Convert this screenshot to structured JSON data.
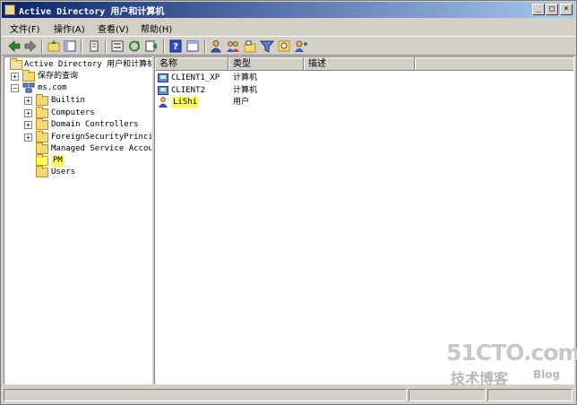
{
  "window": {
    "title": "Active Directory 用户和计算机",
    "minimize": "_",
    "maximize": "□",
    "close": "×"
  },
  "menu": {
    "items": [
      "文件(F)",
      "操作(A)",
      "查看(V)",
      "帮助(H)"
    ]
  },
  "tree": {
    "root": "Active Directory 用户和计算机",
    "saved_queries": "保存的查询",
    "domain": "ms.com",
    "children": [
      "Builtin",
      "Computers",
      "Domain Controllers",
      "ForeignSecurityPrincip",
      "Managed Service Accour",
      "PM",
      "Users"
    ],
    "selected": "PM"
  },
  "list": {
    "columns": [
      "名称",
      "类型",
      "描述"
    ],
    "rows": [
      {
        "name": "CLIENT1_XP",
        "type": "计算机",
        "icon": "computer-icon"
      },
      {
        "name": "CLIENT2",
        "type": "计算机",
        "icon": "computer-icon"
      },
      {
        "name": "LiShi",
        "type": "用户",
        "icon": "user-icon"
      }
    ]
  },
  "watermark": {
    "line1": "51CTO.com",
    "line2": "技术博客",
    "line3": "Blog"
  },
  "colors": {
    "highlight": "#ffff60",
    "titlebar_start": "#0a246a",
    "titlebar_end": "#a6caf0"
  }
}
